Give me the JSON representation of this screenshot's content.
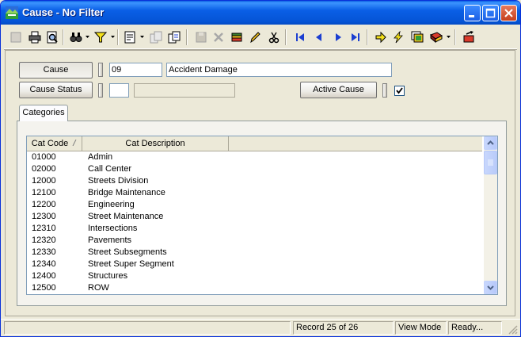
{
  "window": {
    "title": "Cause - No Filter"
  },
  "form": {
    "cause_button": "Cause",
    "cause_code": "09",
    "cause_description": "Accident Damage",
    "cause_status_button": "Cause Status",
    "cause_status_code": "",
    "cause_status_description": "",
    "active_cause_button": "Active Cause",
    "active_cause_checked": true
  },
  "tabs": [
    {
      "label": "Categories"
    }
  ],
  "grid": {
    "columns": [
      {
        "label": "Cat Code",
        "sort": "ascending"
      },
      {
        "label": "Cat Description"
      }
    ],
    "rows": [
      {
        "code": "01000",
        "desc": "Admin"
      },
      {
        "code": "02000",
        "desc": "Call Center"
      },
      {
        "code": "12000",
        "desc": "Streets Division"
      },
      {
        "code": "12100",
        "desc": "Bridge Maintenance"
      },
      {
        "code": "12200",
        "desc": "Engineering"
      },
      {
        "code": "12300",
        "desc": "Street Maintenance"
      },
      {
        "code": "12310",
        "desc": "Intersections"
      },
      {
        "code": "12320",
        "desc": "Pavements"
      },
      {
        "code": "12330",
        "desc": "Street Subsegments"
      },
      {
        "code": "12340",
        "desc": "Street Super Segment"
      },
      {
        "code": "12400",
        "desc": "Structures"
      },
      {
        "code": "12500",
        "desc": "ROW"
      }
    ]
  },
  "status": {
    "record": "Record 25 of 26",
    "mode": "View Mode",
    "state": "Ready..."
  },
  "colors": {
    "title_bar": "#0554d5",
    "close_button": "#c53f1d",
    "toolbar_blue": "#1c3fd1"
  }
}
